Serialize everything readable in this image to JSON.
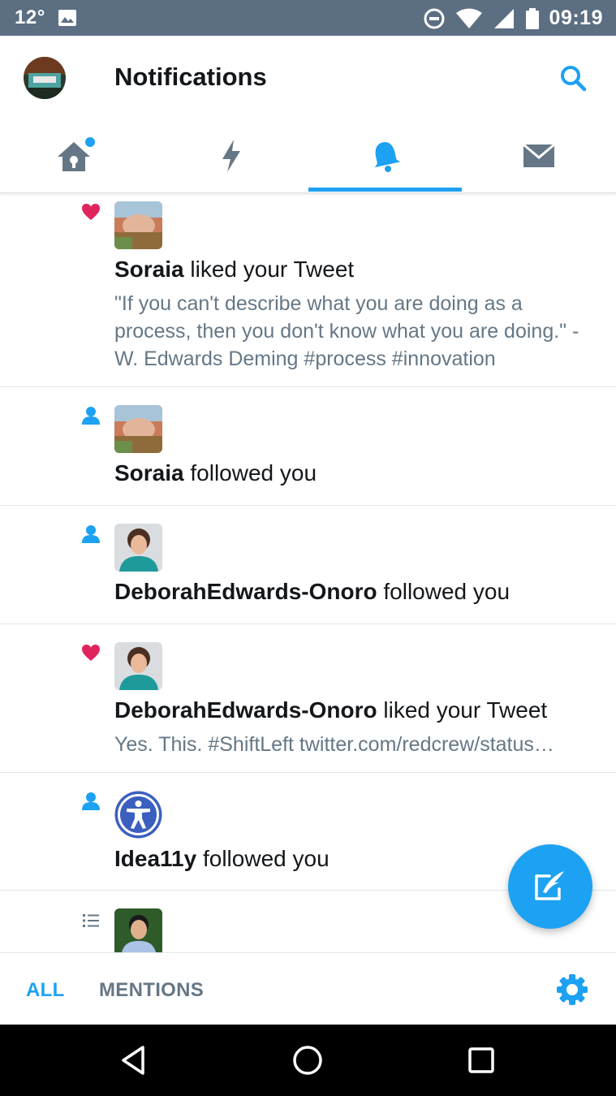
{
  "status_bar": {
    "temperature": "12°",
    "time": "09:19",
    "icons": [
      "image-icon",
      "do-not-disturb-icon",
      "wifi-icon",
      "signal-icon",
      "battery-icon"
    ]
  },
  "header": {
    "title": "Notifications",
    "icons": [
      "avatar",
      "search-icon"
    ]
  },
  "tabs": [
    {
      "name": "home",
      "icon": "home-icon",
      "has_dot": true
    },
    {
      "name": "moments",
      "icon": "lightning-icon"
    },
    {
      "name": "notifications",
      "icon": "bell-icon",
      "active": true
    },
    {
      "name": "messages",
      "icon": "envelope-icon"
    }
  ],
  "notifications": [
    {
      "kind": "like",
      "icon": "heart-icon",
      "user": "Soraia",
      "action": " liked your Tweet",
      "snippet_lines": [
        "\"If you can't describe what you are doing as a",
        "process, then you don't know what you are doing.\" -",
        "W. Edwards Deming #process #innovation"
      ]
    },
    {
      "kind": "follow",
      "icon": "person-icon",
      "user": "Soraia",
      "action": " followed you"
    },
    {
      "kind": "follow",
      "icon": "person-icon",
      "user": "DeborahEdwards-Onoro",
      "action": " followed you"
    },
    {
      "kind": "like",
      "icon": "heart-icon",
      "user": "DeborahEdwards-Onoro",
      "action": " liked your Tweet",
      "snippet": "Yes. This. #ShiftLeft twitter.com/redcrew/status…"
    },
    {
      "kind": "follow",
      "icon": "person-icon",
      "user": "Idea11y",
      "action": " followed you"
    },
    {
      "kind": "list",
      "icon": "list-icon"
    }
  ],
  "filters": {
    "all": "ALL",
    "mentions": "MENTIONS"
  },
  "colors": {
    "accent": "#1da1f2",
    "heart": "#e0245e",
    "secondary_text": "#657786",
    "status_bar": "#5c6e82"
  }
}
